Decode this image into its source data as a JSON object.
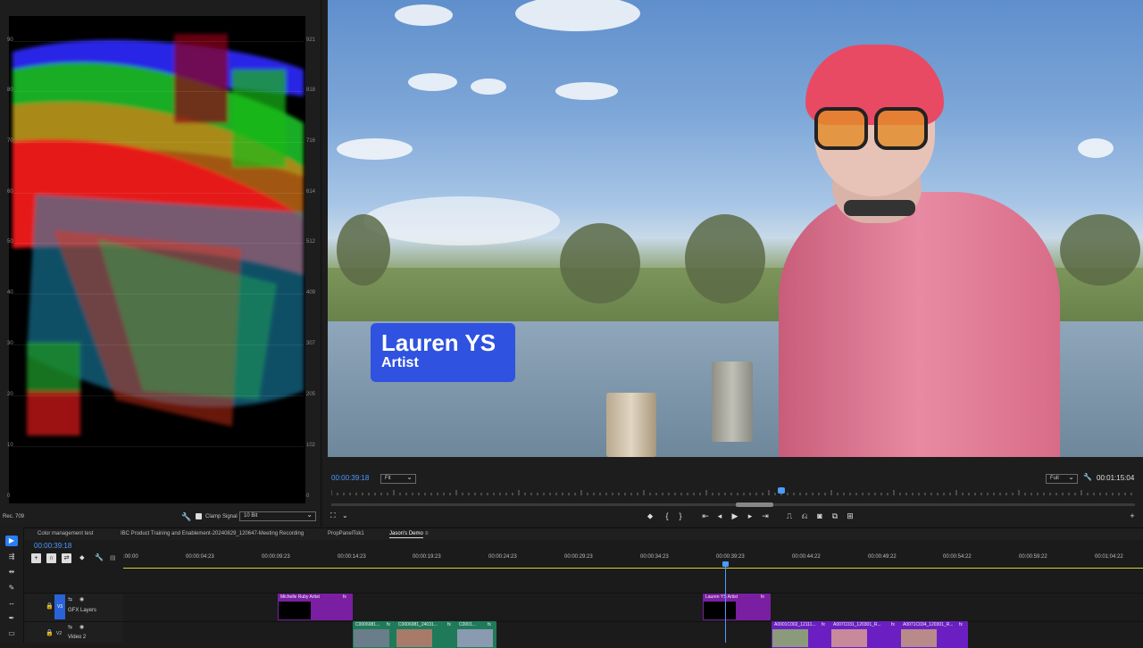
{
  "scope": {
    "left_ticks": [
      "90",
      "80",
      "70",
      "60",
      "50",
      "40",
      "30",
      "20",
      "10",
      "0"
    ],
    "right_ticks": [
      "921",
      "818",
      "716",
      "614",
      "512",
      "409",
      "307",
      "205",
      "102",
      "0"
    ],
    "color_space": "Rec. 709",
    "clamp_label": "Clamp Signal",
    "bit_depth": "10 Bit"
  },
  "program": {
    "timecode": "00:00:39:18",
    "fit_option": "Fit",
    "quality_option": "Full",
    "duration": "00:01:15:04",
    "lower_third": {
      "name": "Lauren YS",
      "role": "Artist"
    }
  },
  "tabs": [
    {
      "label": "Color management test",
      "active": false
    },
    {
      "label": "IBC Product Training and Enablement-20240829_120647-Meeting Recording",
      "active": false
    },
    {
      "label": "PropPanelTok1",
      "active": false
    },
    {
      "label": "Jason's Demo",
      "active": true
    }
  ],
  "timeline": {
    "timecode": "00:00:39:18",
    "ruler": [
      ":00:00",
      "00:00:04:23",
      "00:00:09:23",
      "00:00:14:23",
      "00:00:19:23",
      "00:00:24:23",
      "00:00:29:23",
      "00:00:34:23",
      "00:00:39:23",
      "00:00:44:22",
      "00:00:49:22",
      "00:00:54:22",
      "00:00:59:22",
      "00:01:04:22"
    ],
    "tracks": [
      {
        "id": "V3",
        "name": "GFX Layers"
      },
      {
        "id": "V2",
        "name": "Video 2"
      }
    ],
    "clips_v3": [
      {
        "label": "Michelle Ruby Artist"
      },
      {
        "label": "Lauren YS Artist"
      }
    ],
    "clips_v2": [
      {
        "label": "C0006981..."
      },
      {
        "label": "C0006981_24031..."
      },
      {
        "label": "C0001..."
      },
      {
        "label": "A0001C002_12111..."
      },
      {
        "label": "A007C031_120301_R..."
      },
      {
        "label": "A0071C034_120301_R..."
      }
    ]
  },
  "colors": {
    "accent": "#2a7ef5",
    "timecode": "#4d9bff",
    "lower_third": "#2f52e0",
    "graphics_clip": "#7a1fa2",
    "video_clip": "#1f7a5a",
    "video_clip_alt": "#6b1fc2"
  }
}
